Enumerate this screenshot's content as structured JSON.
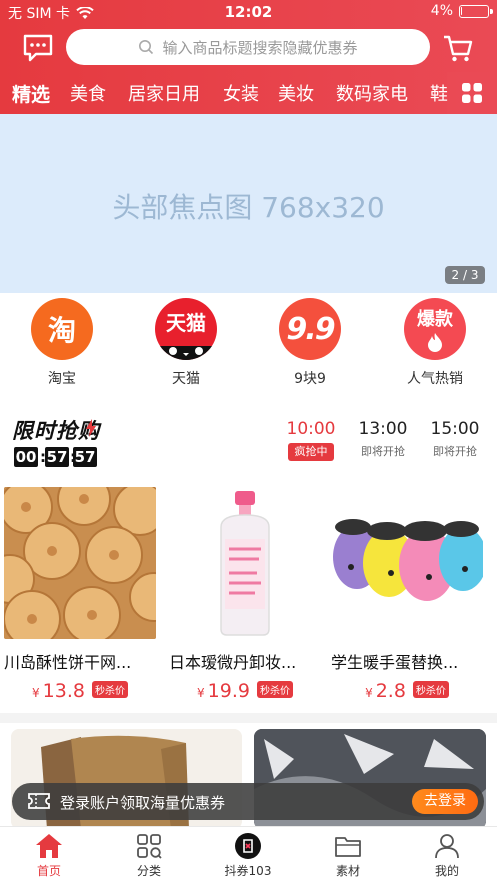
{
  "status_bar": {
    "carrier": "无 SIM 卡",
    "time": "12:02",
    "battery": "4%",
    "battery_level": 0.04
  },
  "search": {
    "placeholder": "输入商品标题搜索隐藏优惠券"
  },
  "tabs": [
    {
      "label": "精选",
      "active": true
    },
    {
      "label": "美食"
    },
    {
      "label": "居家日用"
    },
    {
      "label": "女装"
    },
    {
      "label": "美妆"
    },
    {
      "label": "数码家电"
    },
    {
      "label": "鞋"
    }
  ],
  "banner": {
    "text": "头部焦点图  768x320",
    "pager": "2 / 3"
  },
  "entries": [
    {
      "label": "淘宝",
      "icon_text": "淘",
      "icon": "taobao-icon",
      "color": "#f56a1f"
    },
    {
      "label": "天猫",
      "icon_text": "天猫",
      "icon": "tmall-icon",
      "color": "#e8202d"
    },
    {
      "label": "9块9",
      "icon_text": "9.9",
      "icon": "nine-nine-icon",
      "color": "#f4503d"
    },
    {
      "label": "人气热销",
      "icon_text": "爆款",
      "icon": "hot-sale-icon",
      "color": "#f44a52"
    }
  ],
  "flash_sale": {
    "title": "限时抢购",
    "countdown": [
      "00",
      "57",
      "57"
    ],
    "slots": [
      {
        "time": "10:00",
        "status": "疯抢中",
        "active": true
      },
      {
        "time": "13:00",
        "status": "即将开抢"
      },
      {
        "time": "15:00",
        "status": "即将开抢"
      }
    ]
  },
  "products": [
    {
      "name": "川岛酥性饼干网...",
      "currency": "¥",
      "price": "13.8",
      "tag": "秒杀价",
      "image": "biscuits"
    },
    {
      "name": "日本瑷微丹卸妆...",
      "currency": "¥",
      "price": "19.9",
      "tag": "秒杀价",
      "image": "makeup-remover-bottle"
    },
    {
      "name": "学生暖手蛋替换...",
      "currency": "¥",
      "price": "2.8",
      "tag": "秒杀价",
      "image": "hand-warmers"
    }
  ],
  "login_bar": {
    "text": "登录账户领取海量优惠券",
    "button": "去登录"
  },
  "bottom_nav": [
    {
      "label": "首页",
      "icon": "home-icon",
      "active": true
    },
    {
      "label": "分类",
      "icon": "category-icon"
    },
    {
      "label": "抖券103",
      "icon": "douyin-coupon-icon"
    },
    {
      "label": "素材",
      "icon": "folder-icon"
    },
    {
      "label": "我的",
      "icon": "user-icon"
    }
  ],
  "colors": {
    "brand": "#e53a3f",
    "banner_bg": "#dcebfb",
    "login_button": "#ff7a18"
  }
}
